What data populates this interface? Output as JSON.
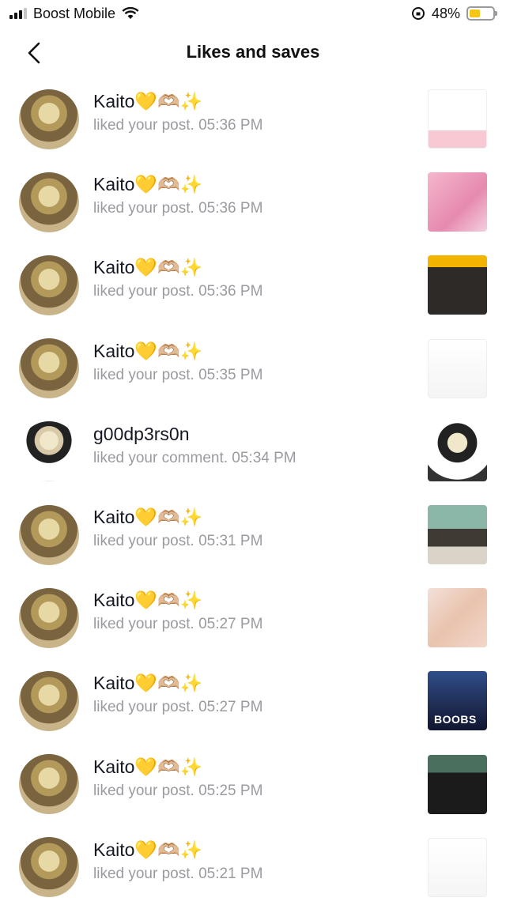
{
  "status_bar": {
    "carrier": "Boost Mobile",
    "battery": "48%",
    "battery_level": 0.48
  },
  "header": {
    "title": "Likes and saves"
  },
  "notifications": [
    {
      "name": "Kaito💛🫶🏼✨",
      "action": "liked your post.",
      "time": "05:36 PM"
    },
    {
      "name": "Kaito💛🫶🏼✨",
      "action": "liked your post.",
      "time": "05:36 PM"
    },
    {
      "name": "Kaito💛🫶🏼✨",
      "action": "liked your post.",
      "time": "05:36 PM"
    },
    {
      "name": "Kaito💛🫶🏼✨",
      "action": "liked your post.",
      "time": "05:35 PM"
    },
    {
      "name": "g00dp3rs0n",
      "action": "liked your comment.",
      "time": "05:34 PM"
    },
    {
      "name": "Kaito💛🫶🏼✨",
      "action": "liked your post.",
      "time": "05:31 PM"
    },
    {
      "name": "Kaito💛🫶🏼✨",
      "action": "liked your post.",
      "time": "05:27 PM"
    },
    {
      "name": "Kaito💛🫶🏼✨",
      "action": "liked your post.",
      "time": "05:27 PM"
    },
    {
      "name": "Kaito💛🫶🏼✨",
      "action": "liked your post.",
      "time": "05:25 PM"
    },
    {
      "name": "Kaito💛🫶🏼✨",
      "action": "liked your post.",
      "time": "05:21 PM"
    }
  ],
  "thumb_text": {
    "boobs": "BOOBS"
  }
}
